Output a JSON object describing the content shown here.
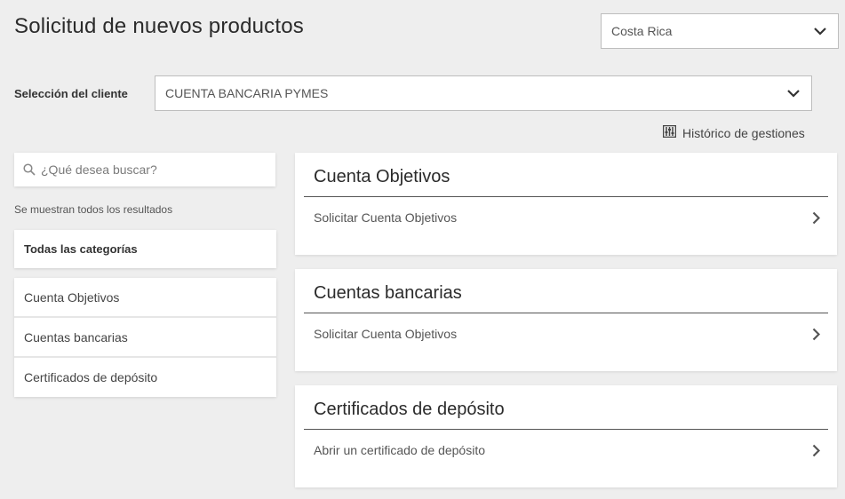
{
  "header": {
    "title": "Solicitud de nuevos productos",
    "country_select": {
      "value": "Costa Rica",
      "icon": "chevron-down-icon"
    }
  },
  "client": {
    "label": "Selección del cliente",
    "value": "CUENTA BANCARIA PYMES",
    "icon": "chevron-down-icon"
  },
  "history": {
    "label": "Histórico de gestiones",
    "icon": "sliders-icon"
  },
  "search": {
    "placeholder": "¿Qué desea buscar?",
    "value": "",
    "icon": "search-icon",
    "results_note": "Se muestran todos los resultados"
  },
  "categories": {
    "all_label": "Todas las categorías",
    "items": [
      {
        "label": "Cuenta Objetivos"
      },
      {
        "label": "Cuentas bancarias"
      },
      {
        "label": "Certificados de depósito"
      }
    ]
  },
  "products": [
    {
      "title": "Cuenta Objetivos",
      "action": "Solicitar Cuenta Objetivos",
      "icon": "chevron-right-icon"
    },
    {
      "title": "Cuentas bancarias",
      "action": "Solicitar Cuenta Objetivos",
      "icon": "chevron-right-icon"
    },
    {
      "title": "Certificados de depósito",
      "action": "Abrir un certificado de depósito",
      "icon": "chevron-right-icon"
    }
  ],
  "colors": {
    "background": "#eeeeee",
    "card": "#ffffff",
    "text": "#333333",
    "rule": "#555555"
  }
}
